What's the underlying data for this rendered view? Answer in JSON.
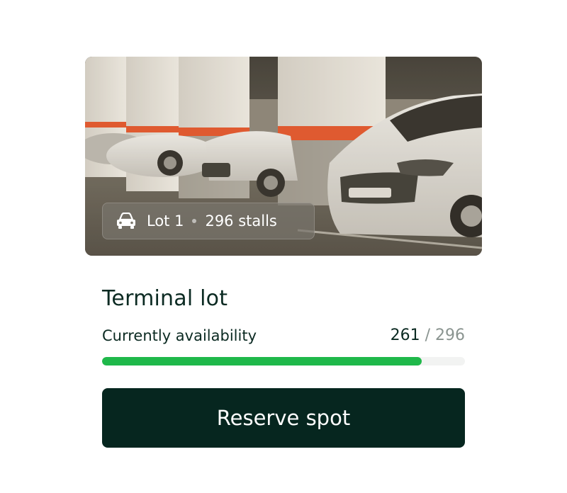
{
  "lot": {
    "lot_label": "Lot 1",
    "stalls_label": "296 stalls",
    "title": "Terminal lot",
    "availability_label": "Currently availability",
    "available": "261",
    "separator": "/",
    "total": "296",
    "fill_fraction": 0.8818
  },
  "actions": {
    "reserve_label": "Reserve spot"
  },
  "colors": {
    "primary_button": "#06261f",
    "progress_fill": "#1fb84a",
    "progress_track": "#f2f3f2",
    "title_text": "#0b2a22",
    "muted_text": "#8a9490",
    "stripe_accent": "#e8542a"
  },
  "icons": {
    "badge_icon": "car-icon"
  }
}
